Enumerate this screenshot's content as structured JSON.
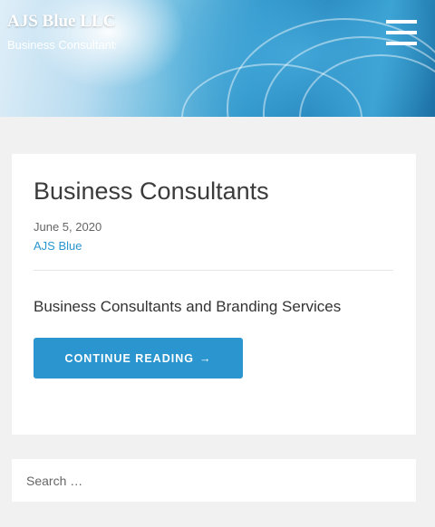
{
  "header": {
    "site_title": "AJS Blue LLC",
    "tagline": "Business Consultants",
    "menu_icon": "hamburger-menu-icon"
  },
  "post": {
    "title": "Business Consultants",
    "date": "June 5, 2020",
    "author": "AJS Blue",
    "excerpt": "Business Consultants and Branding Services",
    "continue_label": "CONTINUE READING",
    "continue_arrow": "→"
  },
  "search": {
    "placeholder": "Search …"
  },
  "colors": {
    "accent": "#2b95cf",
    "background": "#f1f1f1",
    "card": "#ffffff"
  }
}
